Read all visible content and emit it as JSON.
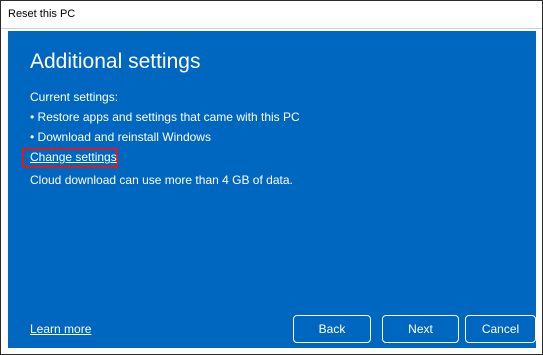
{
  "window": {
    "title": "Reset this PC"
  },
  "page": {
    "heading": "Additional settings",
    "current_label": "Current settings:",
    "bullets": [
      "• Restore apps and settings that came with this PC",
      "• Download and reinstall Windows"
    ],
    "change_link": "Change settings",
    "cloud_note": "Cloud download can use more than 4 GB of data.",
    "learn_more": "Learn more"
  },
  "buttons": {
    "back": "Back",
    "next": "Next",
    "cancel": "Cancel"
  },
  "colors": {
    "background": "#0067c0",
    "text": "#ffffff",
    "highlight_box": "#e11919"
  }
}
